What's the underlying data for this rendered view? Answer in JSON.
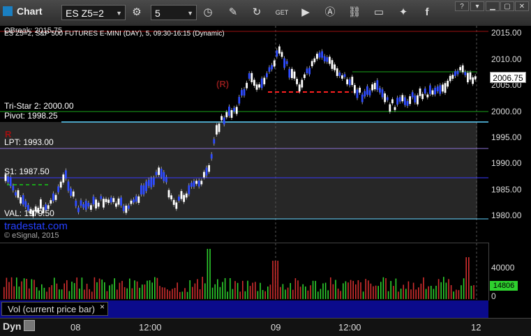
{
  "toolbar": {
    "title": "Chart",
    "symbol": "ES Z5=2",
    "interval": "5",
    "icons": [
      "symbol-settings-icon",
      "clock-icon",
      "pencil-icon",
      "refresh-icon",
      "get-icon",
      "play-icon",
      "a-icon",
      "link-icon",
      "comment-icon",
      "twitter-icon",
      "facebook-icon"
    ]
  },
  "chart": {
    "symbol_line": "ES Z5=2, S&P 500 FUTURES E-MINI (DAY), 5, 09:30-16:15 (Dynamic)",
    "top_label": "OBreak: 2015.75",
    "levels": {
      "tristar": "Tri-Star 2: 2000.00",
      "pivot": "Pivot: 1998.25",
      "r_marker": "R",
      "lpt": "LPT: 1993.00",
      "s1": "S1: 1987.50",
      "val": "VAL: 1979.50",
      "r_marker2": "(R)"
    },
    "watermark": "tradestat.com",
    "copyright": "© eSignal, 2015",
    "colors": {
      "up": "#2f4cff",
      "down": "#ffffff",
      "green_line": "#1aa31a",
      "blue_line": "#3a3aff",
      "cyan_line": "#5fd3ff",
      "purple_line": "#8a6fd1",
      "red_dash": "#ff2020",
      "seq": "#1fa81f"
    }
  },
  "price_axis": {
    "ticks": [
      "2015.00",
      "2010.00",
      "2005.00",
      "2000.00",
      "1995.00",
      "1990.00",
      "1985.00",
      "1980.00"
    ],
    "current": "2006.75"
  },
  "volume": {
    "label": "Vol (current price bar)",
    "close": "×",
    "ticks": [
      "40000",
      "0"
    ],
    "current": "14806"
  },
  "time_axis": {
    "dyn": "Dyn",
    "ticks": [
      "08",
      "12:00",
      "09",
      "12:00",
      "12"
    ]
  }
}
